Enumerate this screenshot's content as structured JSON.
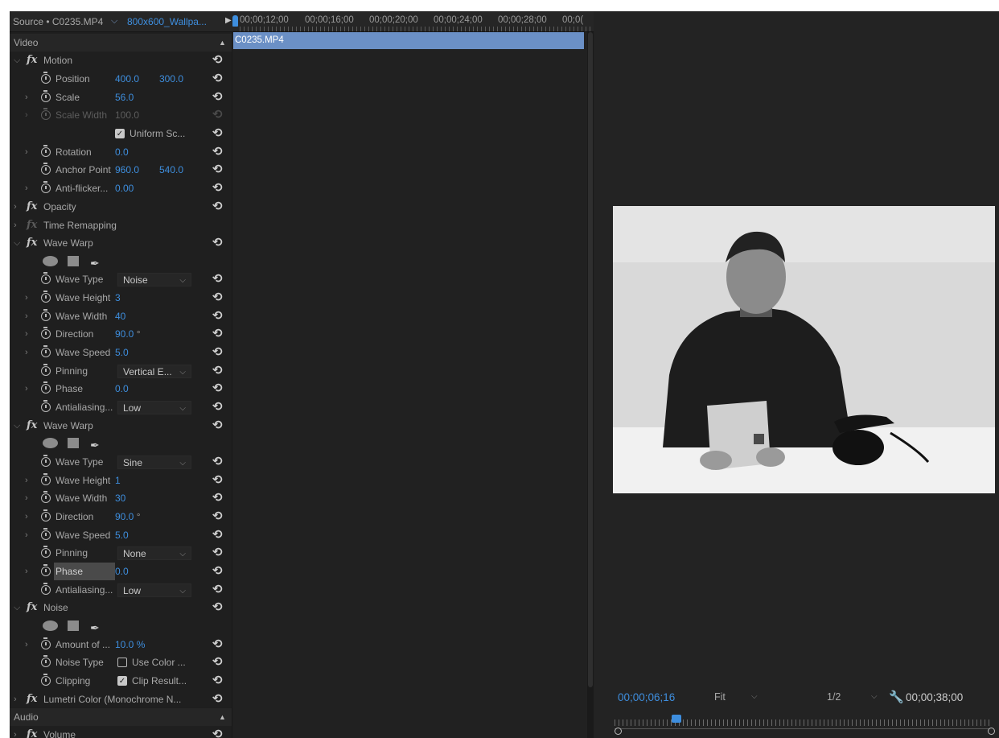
{
  "header": {
    "source_label": "Source • C0235.MP4",
    "sequence_label": "800x600_Wallpa...",
    "ruler_timecodes": [
      "00;00;12;00",
      "00;00;16;00",
      "00;00;20;00",
      "00;00;24;00",
      "00;00;28;00",
      "00;0("
    ]
  },
  "timeline": {
    "clip_name": "C0235.MP4"
  },
  "effects": {
    "video_section": "Video",
    "audio_section": "Audio",
    "motion": {
      "name": "Motion",
      "position_label": "Position",
      "position_x": "400.0",
      "position_y": "300.0",
      "scale_label": "Scale",
      "scale_value": "56.0",
      "scale_width_label": "Scale Width",
      "scale_width_value": "100.0",
      "uniform_scale_label": "Uniform Sc...",
      "rotation_label": "Rotation",
      "rotation_value": "0.0",
      "anchor_label": "Anchor Point",
      "anchor_x": "960.0",
      "anchor_y": "540.0",
      "antiflicker_label": "Anti-flicker...",
      "antiflicker_value": "0.00"
    },
    "opacity": {
      "name": "Opacity"
    },
    "time_remapping": {
      "name": "Time Remapping"
    },
    "wave_warp_1": {
      "name": "Wave Warp",
      "wave_type_label": "Wave Type",
      "wave_type_value": "Noise",
      "wave_height_label": "Wave Height",
      "wave_height_value": "3",
      "wave_width_label": "Wave Width",
      "wave_width_value": "40",
      "direction_label": "Direction",
      "direction_value": "90.0",
      "direction_unit": "°",
      "wave_speed_label": "Wave Speed",
      "wave_speed_value": "5.0",
      "pinning_label": "Pinning",
      "pinning_value": "Vertical E...",
      "phase_label": "Phase",
      "phase_value": "0.0",
      "antialiasing_label": "Antialiasing...",
      "antialiasing_value": "Low"
    },
    "wave_warp_2": {
      "name": "Wave Warp",
      "wave_type_label": "Wave Type",
      "wave_type_value": "Sine",
      "wave_height_label": "Wave Height",
      "wave_height_value": "1",
      "wave_width_label": "Wave Width",
      "wave_width_value": "30",
      "direction_label": "Direction",
      "direction_value": "90.0",
      "direction_unit": "°",
      "wave_speed_label": "Wave Speed",
      "wave_speed_value": "5.0",
      "pinning_label": "Pinning",
      "pinning_value": "None",
      "phase_label": "Phase",
      "phase_value": "0.0",
      "antialiasing_label": "Antialiasing...",
      "antialiasing_value": "Low"
    },
    "noise": {
      "name": "Noise",
      "amount_label": "Amount of ...",
      "amount_value": "10.0",
      "amount_unit": "%",
      "noise_type_label": "Noise Type",
      "use_color_label": "Use Color ...",
      "clipping_label": "Clipping",
      "clip_result_label": "Clip Result..."
    },
    "lumetri": {
      "name": "Lumetri Color (Monochrome N..."
    },
    "volume": {
      "name": "Volume"
    }
  },
  "monitor": {
    "current_timecode": "00;00;06;16",
    "fit_label": "Fit",
    "resolution_label": "1/2",
    "duration_timecode": "00;00;38;00"
  },
  "colors": {
    "accent": "#3e8ede",
    "clip": "#6b90c6",
    "panel": "#1f1f1f"
  }
}
